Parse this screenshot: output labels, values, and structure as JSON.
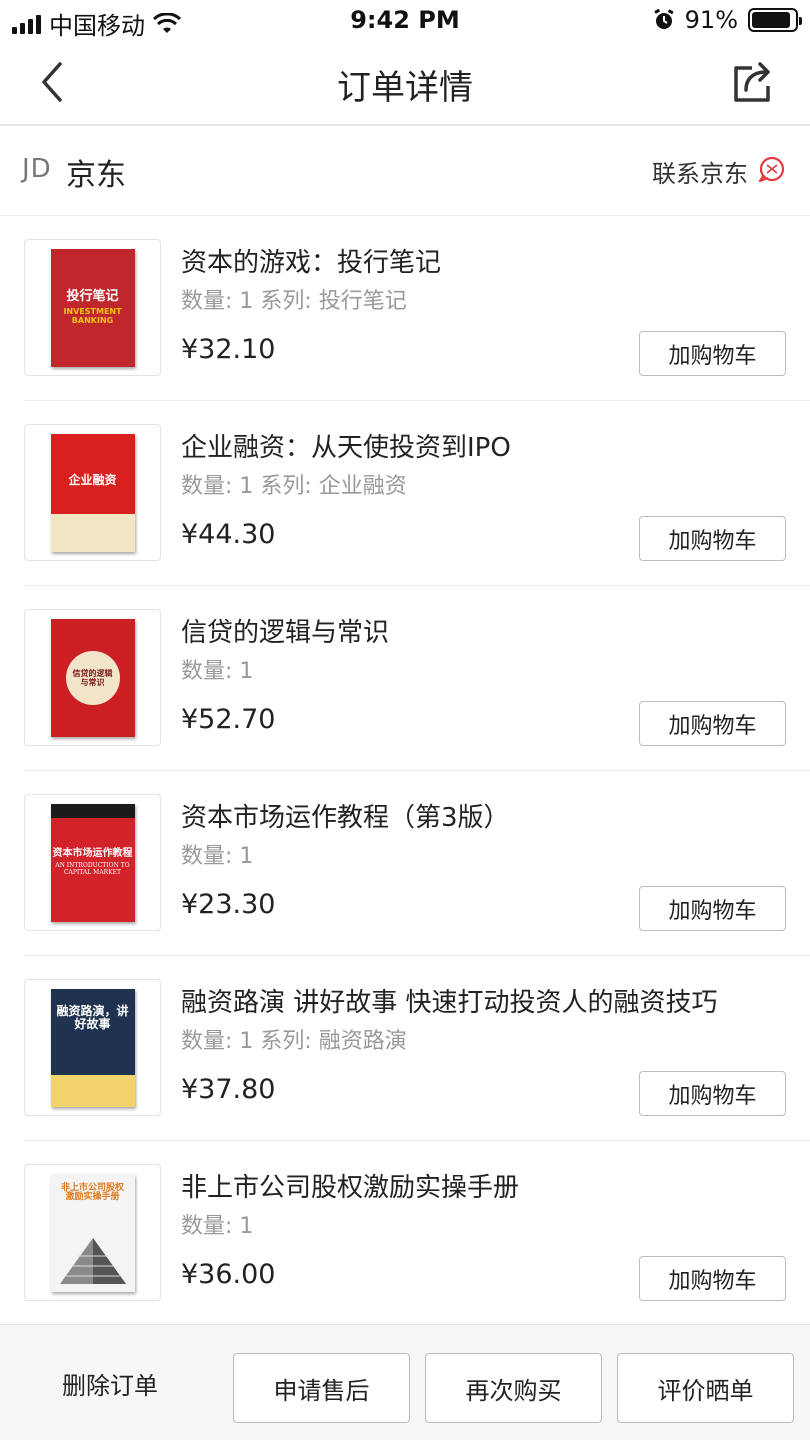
{
  "status_bar": {
    "carrier": "中国移动",
    "time": "9:42 PM",
    "battery": "91%",
    "battery_level": 0.91
  },
  "nav": {
    "title": "订单详情",
    "back_icon": "chevron-left-icon",
    "share_icon": "share-icon"
  },
  "shop": {
    "logo": "JD",
    "name": "京东",
    "contact_label": "联系京东",
    "contact_icon": "chat-bubble-icon",
    "accent": "#e4393c"
  },
  "items": [
    {
      "title": "资本的游戏：投行笔记",
      "meta": "数量: 1 系列: 投行笔记",
      "price": "¥32.10",
      "cart_label": "加购物车",
      "cover_text": "投行笔记",
      "cover_sub": "INVESTMENT BANKING",
      "cover_color": "#c0272d"
    },
    {
      "title": "企业融资：从天使投资到IPO",
      "meta": "数量: 1 系列: 企业融资",
      "price": "¥44.30",
      "cart_label": "加购物车",
      "cover_text": "企业融资",
      "cover_sub": "",
      "cover_color": "#d8201e"
    },
    {
      "title": "信贷的逻辑与常识",
      "meta": "数量: 1",
      "price": "¥52.70",
      "cart_label": "加购物车",
      "cover_text": "信贷的逻辑与常识",
      "cover_sub": "",
      "cover_color": "#cc1f24"
    },
    {
      "title": "资本市场运作教程（第3版）",
      "meta": "数量: 1",
      "price": "¥23.30",
      "cart_label": "加购物车",
      "cover_text": "资本市场运作教程",
      "cover_sub": "AN INTRODUCTION TO CAPITAL MARKET",
      "cover_color": "#d3232a"
    },
    {
      "title": "融资路演 讲好故事  快速打动投资人的融资技巧",
      "meta": "数量: 1 系列: 融资路演",
      "price": "¥37.80",
      "cart_label": "加购物车",
      "cover_text": "融资路演，讲好故事",
      "cover_sub": "",
      "cover_color": "#1f3350"
    },
    {
      "title": "非上市公司股权激励实操手册",
      "meta": "数量: 1",
      "price": "¥36.00",
      "cart_label": "加购物车",
      "cover_text": "非上市公司股权激励实操手册",
      "cover_sub": "",
      "cover_color": "#f4f4f4"
    }
  ],
  "bottom": {
    "delete_label": "删除订单",
    "after_sale_label": "申请售后",
    "rebuy_label": "再次购买",
    "review_label": "评价晒单"
  }
}
